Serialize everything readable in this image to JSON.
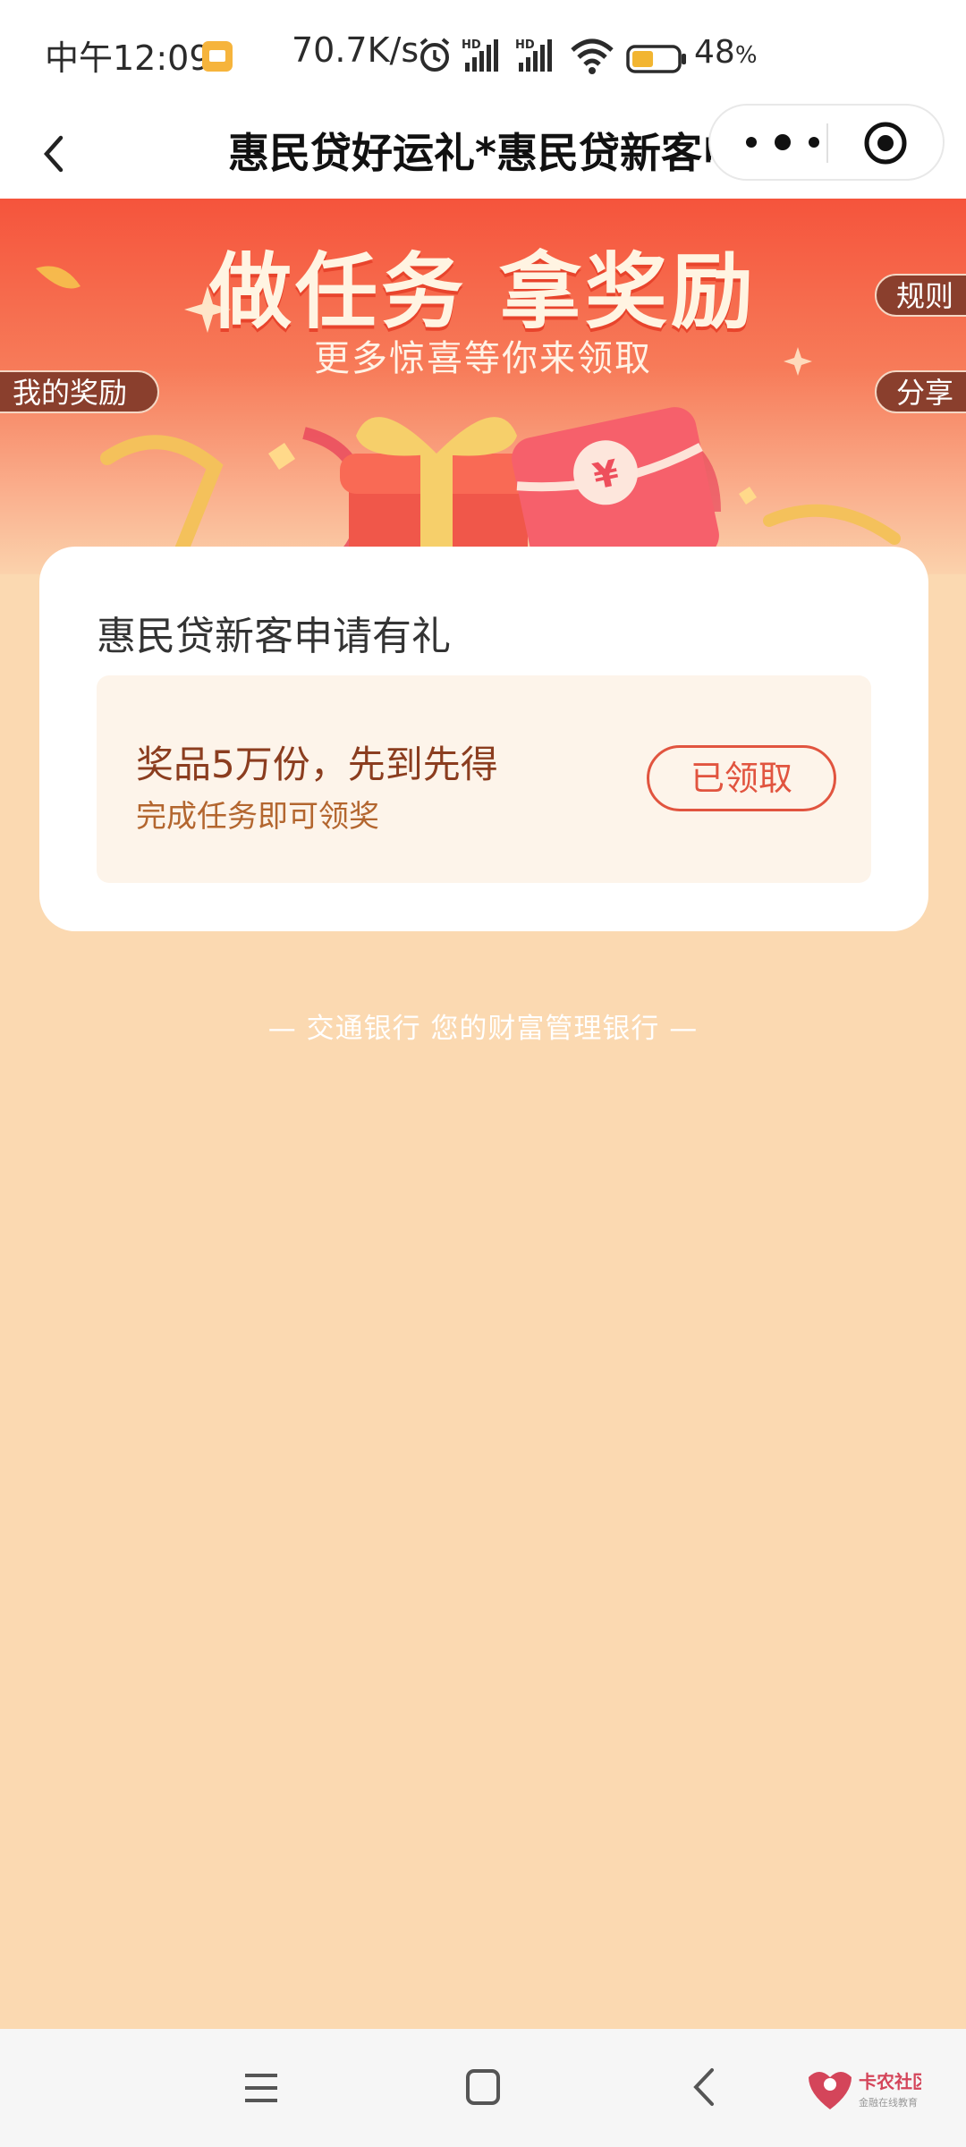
{
  "status_bar": {
    "time": "中午12:09",
    "net_speed": "70.7K/s",
    "battery_percent": "48",
    "battery_unit": "%",
    "battery_level": 0.48,
    "icons": [
      "notification-icon",
      "alarm-icon",
      "signal-hd-icon",
      "signal-hd-icon",
      "wifi-icon",
      "battery-icon"
    ]
  },
  "nav": {
    "title": "惠民贷好运礼*惠民贷新客申请有礼",
    "back_icon": "chevron-left-icon",
    "more_icon": "more-dots-icon",
    "close_icon": "target-icon"
  },
  "banner": {
    "title": "做任务 拿奖励",
    "subtitle": "更多惊喜等你来领取",
    "rules_label": "规则",
    "share_label": "分享",
    "my_rewards_label": "我的奖励"
  },
  "card": {
    "title": "惠民贷新客申请有礼",
    "prize_title": "奖品5万份，先到先得",
    "prize_subtitle": "完成任务即可领奖",
    "button_label": "已领取"
  },
  "footer": {
    "text": "— 交通银行 您的财富管理银行 —"
  },
  "watermark": {
    "name": "卡农社区",
    "tagline": "金融在线教育"
  },
  "colors": {
    "page_bg": "#fbd9b1",
    "banner_top": "#f5543c",
    "accent": "#e1543f",
    "tab_bg": "#8a3f2d",
    "prize_text": "#8b3d1f"
  }
}
